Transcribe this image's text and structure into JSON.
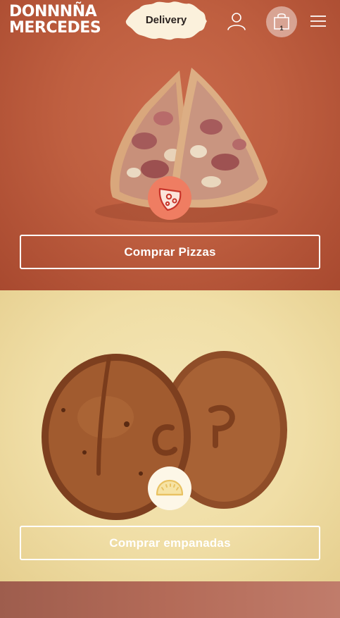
{
  "header": {
    "logo_line1": "DONNNÑA",
    "logo_line2": "MERCEDES",
    "delivery_label": "Delivery",
    "cart_count": "1",
    "icons": {
      "account": "user-icon",
      "cart": "shopping-bag-icon",
      "menu": "hamburger-menu-icon"
    }
  },
  "pizza_section": {
    "button_label": "Comprar Pizzas",
    "icon": "pizza-slice-icon",
    "background_color": "#bf5f40"
  },
  "empanada_section": {
    "button_label": "Comprar empanadas",
    "icon": "empanada-icon",
    "background_color": "#f0dea6"
  },
  "colors": {
    "icon_badge_pizza": "#ef7d62",
    "icon_badge_empanada": "#fdf7e7",
    "button_border": "#ffffff"
  }
}
